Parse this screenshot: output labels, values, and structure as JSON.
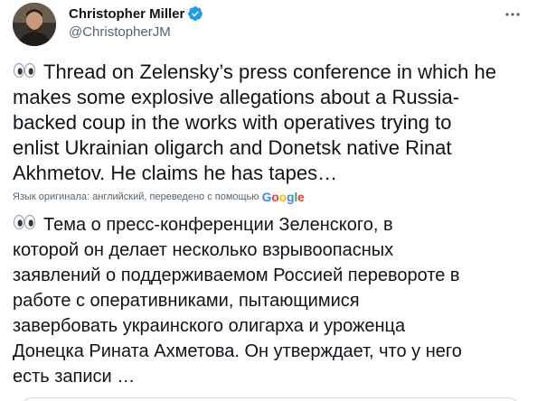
{
  "author": {
    "display_name": "Christopher Miller",
    "handle": "@ChristopherJM",
    "verified": true,
    "avatar": "avatar-photo"
  },
  "icons": {
    "verified": "verified-badge-icon",
    "more": "more-options-icon",
    "emoji": "eyes-emoji-icon",
    "accent": "#1d9bf0"
  },
  "tweet": {
    "text": "Thread on Zelensky’s press conference in which he makes some explosive allegations about a Russia-backed coup in the works with operatives trying to enlist Ukrainian oligarch and Donetsk native Rinat Akhmetov. He claims he has tapes…",
    "text_line_1": "Thread on Zelensky’s press conference in which he",
    "text_lines_rest": "makes some explosive allegations about a Russia-\nbacked coup in the works with operatives trying to\nenlist Ukrainian oligarch and Donetsk native Rinat\nAkhmetov. He claims he has tapes…"
  },
  "translation": {
    "note": "Язык оригинала: английский, переведено с помощью",
    "provider": "Google",
    "text_line_1": "Тема о пресс-конференции Зеленского, в",
    "text_lines_rest": "которой он делает несколько взрывоопасных\nзаявлений о поддерживаемом Россией перевороте в\nработе с оперативниками, пытающимися\nзавербовать украинского олигарха и уроженца\nДонецка Рината Ахметова. Он утверждает, что у него\nесть записи …"
  }
}
